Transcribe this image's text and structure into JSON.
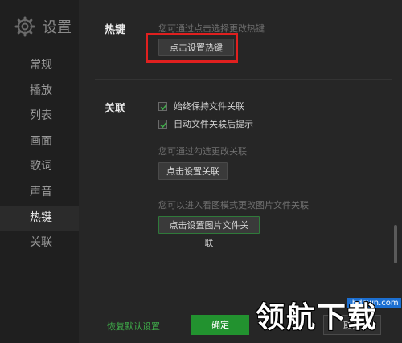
{
  "sidebar": {
    "title": "设置",
    "icon": "gear-icon",
    "items": [
      {
        "label": "常规"
      },
      {
        "label": "播放"
      },
      {
        "label": "列表"
      },
      {
        "label": "画面"
      },
      {
        "label": "歌词"
      },
      {
        "label": "声音"
      },
      {
        "label": "热键"
      },
      {
        "label": "关联"
      }
    ],
    "active_index": 6
  },
  "hotkey": {
    "title": "热键",
    "hint": "您可通过点击选择更改热键",
    "button_label": "点击设置热键"
  },
  "association": {
    "title": "关联",
    "options": [
      {
        "label": "始终保持文件关联",
        "checked": true
      },
      {
        "label": "自动文件关联后提示",
        "checked": true
      }
    ],
    "hint1": "您可通过勾选更改关联",
    "button1_label": "点击设置关联",
    "hint2": "您可以进入看图模式更改图片文件关联",
    "button2_label": "点击设置图片文件关联"
  },
  "footer": {
    "restore_label": "恢复默认设置",
    "ok_label": "确定",
    "cancel_label": "取消"
  },
  "watermark": {
    "text": "领航下载",
    "url": "lhdown.com"
  },
  "colors": {
    "accent_green": "#22922f",
    "link_green": "#3fae4a",
    "highlight_red": "#e0201f"
  }
}
